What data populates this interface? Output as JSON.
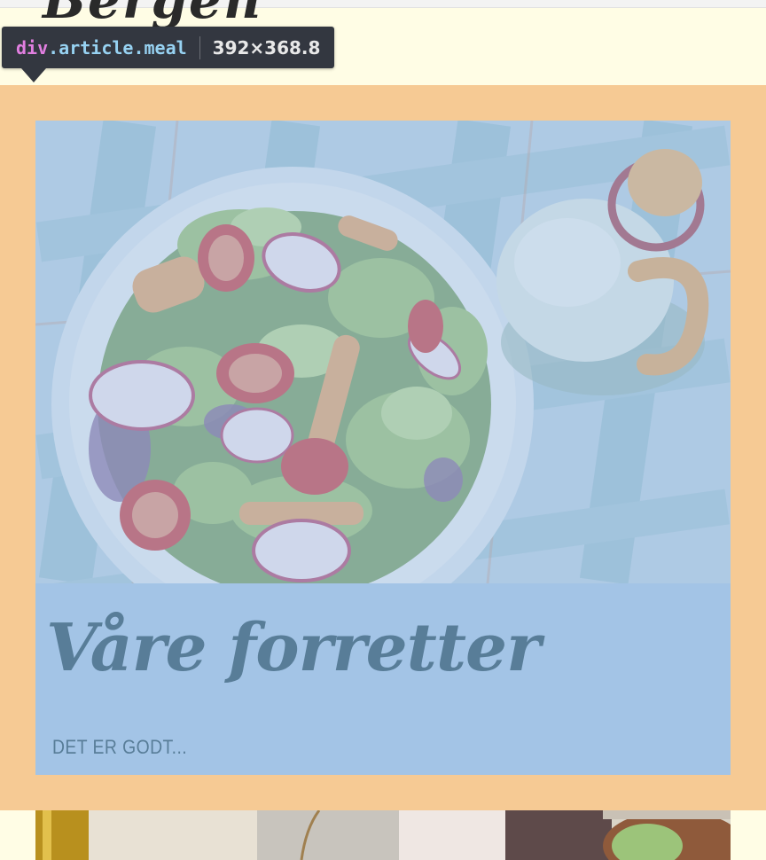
{
  "header": {
    "site_heading": "Bergen"
  },
  "inspector": {
    "tag": "div",
    "class_name": ".article.meal",
    "dimensions": "392×368.8",
    "margin_color": "#f6ca94",
    "content_overlay_color": "#a3c4e6"
  },
  "meal": {
    "title": "Våre forretter",
    "description": "DET ER GODT...",
    "image_subject": "salad-bowl-photo"
  },
  "colors": {
    "page_background": "#fffde5",
    "title_text": "#587d98",
    "tooltip_background": "#333740"
  }
}
